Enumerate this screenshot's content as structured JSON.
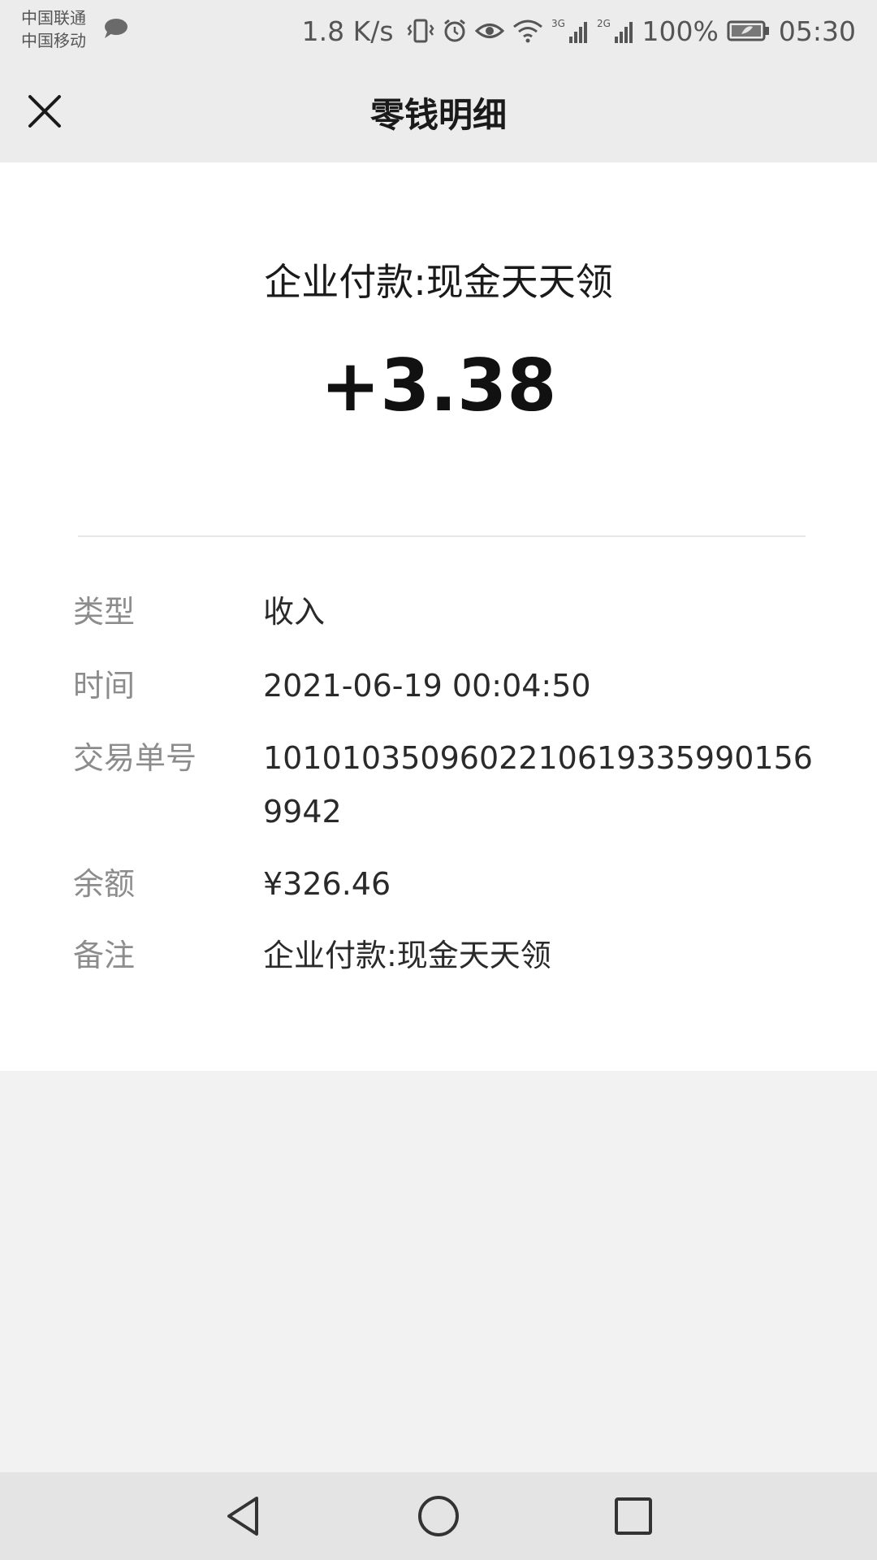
{
  "status_bar": {
    "carrier_1": "中国联通",
    "carrier_2": "中国移动",
    "net_speed": "1.8 K/s",
    "signal_1_label": "3G",
    "signal_2_label": "2G",
    "battery": "100%",
    "time": "05:30",
    "icons": [
      "chat-bubble-icon",
      "vibrate-icon",
      "alarm-icon",
      "eye-icon",
      "wifi-icon",
      "signal-icon",
      "battery-icon"
    ]
  },
  "header": {
    "title": "零钱明细",
    "close_icon": "close-icon"
  },
  "transaction": {
    "title": "企业付款:现金天天领",
    "amount": "+3.38",
    "details": [
      {
        "label": "类型",
        "value": "收入"
      },
      {
        "label": "时间",
        "value": "2021-06-19 00:04:50"
      },
      {
        "label": "交易单号",
        "value": "1010103509602210619335990156 9942"
      },
      {
        "label": "余额",
        "value": "¥326.46"
      },
      {
        "label": "备注",
        "value": "企业付款:现金天天领"
      }
    ]
  },
  "nav_bar": {
    "icons": [
      "back-icon",
      "home-icon",
      "recents-icon"
    ]
  },
  "colors": {
    "background": "#f2f2f2",
    "card": "#ffffff",
    "label": "#8c8c8c",
    "value": "#2a2a2a"
  }
}
